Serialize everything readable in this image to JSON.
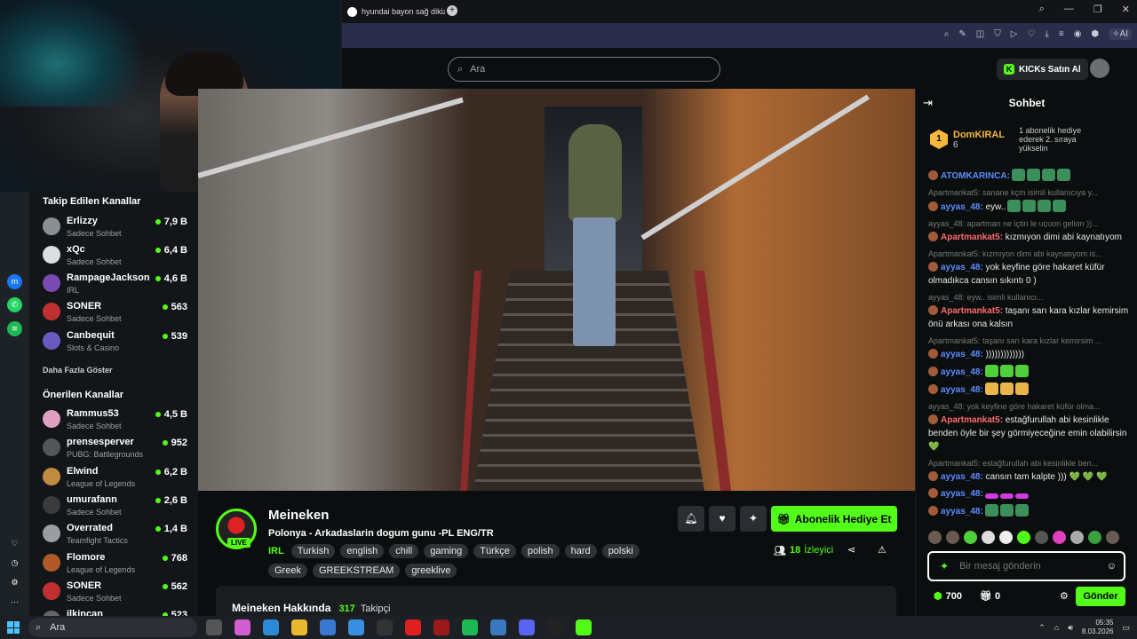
{
  "browser": {
    "tab_title": "hyundai bayon sağ dikiz a",
    "new_tab": "+",
    "ai_label": "AI"
  },
  "topbar": {
    "search_placeholder": "Ara",
    "kicks_label": "KICKs Satın Al"
  },
  "sidebar": {
    "followed_title": "Takip Edilen Kanallar",
    "followed": [
      {
        "name": "Erlizzy",
        "category": "Sadece Sohbet",
        "viewers": "7,9 B",
        "color": "#8a8f94"
      },
      {
        "name": "xQc",
        "category": "Sadece Sohbet",
        "viewers": "6,4 B",
        "color": "#dddddd"
      },
      {
        "name": "RampageJackson",
        "category": "IRL",
        "viewers": "4,6 B",
        "color": "#7a4ab0"
      },
      {
        "name": "SONER",
        "category": "Sadece Sohbet",
        "viewers": "563",
        "color": "#c03030"
      },
      {
        "name": "Canbequit",
        "category": "Slots & Casino",
        "viewers": "539",
        "color": "#6a5ac0"
      }
    ],
    "more_label": "Daha Fazla Göster",
    "suggested_title": "Önerilen Kanallar",
    "suggested": [
      {
        "name": "Rammus53",
        "category": "Sadece Sohbet",
        "viewers": "4,5 B",
        "color": "#e0a0c0"
      },
      {
        "name": "prensesperver",
        "category": "PUBG: Battlegrounds",
        "viewers": "952",
        "color": "#555555"
      },
      {
        "name": "Elwind",
        "category": "League of Legends",
        "viewers": "6,2 B",
        "color": "#c08a40"
      },
      {
        "name": "umurafann",
        "category": "Sadece Sohbet",
        "viewers": "2,6 B",
        "color": "#3a3a3a"
      },
      {
        "name": "Overrated",
        "category": "Teamfight Tactics",
        "viewers": "1,4 B",
        "color": "#9a9ea2"
      },
      {
        "name": "Flomore",
        "category": "League of Legends",
        "viewers": "768",
        "color": "#b05a2a"
      },
      {
        "name": "SONER",
        "category": "Sadece Sohbet",
        "viewers": "562",
        "color": "#c03030"
      },
      {
        "name": "ilkincan",
        "category": "",
        "viewers": "523",
        "color": "#666666"
      }
    ]
  },
  "stream": {
    "streamer": "Meineken",
    "live_label": "LIVE",
    "title": "Polonya - Arkadaslarin dogum gunu -PL ENG/TR",
    "category": "IRL",
    "tags": [
      "Turkish",
      "english",
      "chill",
      "gaming",
      "Türkçe",
      "polish",
      "hard",
      "polski",
      "Greek",
      "GREEKSTREAM",
      "greeklive"
    ],
    "sub_gift_label": "Abonelik Hediye Et",
    "viewers_count": "18",
    "viewers_label": "İzleyici",
    "about_title": "Meineken Hakkında",
    "followers_count": "317",
    "followers_label": "Takipçi"
  },
  "chat": {
    "title": "Sohbet",
    "pinned_rank": "1",
    "pinned_user": "DomKIRAL",
    "pinned_count": "6",
    "pinned_desc": "1 abonelik hediye ederek 2. sıraya yükselin",
    "messages": [
      {
        "reply": "",
        "user": "ATOMKARINCA:",
        "color": "u-blue",
        "text": "",
        "emotes": [
          "em-pepe",
          "em-pepe",
          "em-pepe",
          "em-pepe"
        ]
      },
      {
        "reply": "Apartmankat5: sanane kçm isimli kullanıcıya y...",
        "user": "ayyas_48:",
        "color": "u-blue",
        "text": " eyw..",
        "emotes": [
          "em-pepe",
          "em-pepe",
          "em-pepe",
          "em-pepe"
        ]
      },
      {
        "reply": "ayyas_48: apartman ne içtin le uçuon gelion ))...",
        "user": "Apartmankat5:",
        "color": "u-red",
        "text": " kızmıyon dimi abi kaynatıyom",
        "emotes": []
      },
      {
        "reply": "Apartmankat5: kızmıyon dimi abi kaynatıyom is...",
        "user": "ayyas_48:",
        "color": "u-blue",
        "text": " yok keyfine göre hakaret küfür olmadıkca cansın sıkıntı 0 )",
        "emotes": []
      },
      {
        "reply": "ayyas_48: eyw..   isimli kullanıcı...",
        "user": "Apartmankat5:",
        "color": "u-red",
        "text": " taşanı sarı kara kızlar kemirsim önü arkası ona kalsın",
        "emotes": []
      },
      {
        "reply": "Apartmankat5: taşanı sarı kara kızlar kemirsim ...",
        "user": "ayyas_48:",
        "color": "u-blue",
        "text": " )))))))))))))",
        "emotes": []
      },
      {
        "reply": "",
        "user": "ayyas_48:",
        "color": "u-blue",
        "text": "",
        "emotes": [
          "em-green",
          "em-green",
          "em-green"
        ]
      },
      {
        "reply": "",
        "user": "ayyas_48:",
        "color": "u-blue",
        "text": "",
        "emotes": [
          "em-cat",
          "em-cat",
          "em-cat"
        ]
      },
      {
        "reply": "ayyas_48: yok keyfine göre hakaret küfür olma...",
        "user": "Apartmankat5:",
        "color": "u-red",
        "text": " estağfurullah abi kesinlikle benden öyle bir şey görmiyeceğine emin olabilirsin 💚",
        "emotes": []
      },
      {
        "reply": "Apartmankat5: estağfurullah abi kesinlikle ben...",
        "user": "ayyas_48:",
        "color": "u-blue",
        "text": " cansın tam kalpte ))) 💚 💚 💚",
        "emotes": []
      },
      {
        "reply": "",
        "user": "ayyas_48:",
        "color": "u-blue",
        "text": "",
        "emotes": [
          "em-purple",
          "em-purple",
          "em-purple"
        ]
      },
      {
        "reply": "",
        "user": "ayyas_48:",
        "color": "u-blue",
        "text": "",
        "emotes": [
          "em-pepe",
          "em-pepe",
          "em-pepe"
        ]
      }
    ],
    "input_placeholder": "Bir mesaj gönderin",
    "points": "700",
    "gifts": "0",
    "send_label": "Gönder"
  },
  "taskbar": {
    "search_label": "Ara",
    "time": "05:35",
    "date": "8.03.2026"
  }
}
